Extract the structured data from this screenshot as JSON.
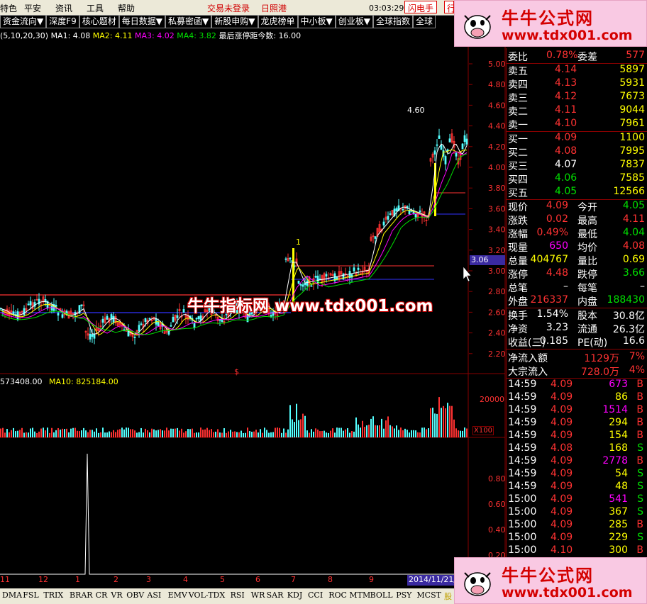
{
  "menubar": {
    "items": [
      "特色",
      "平安",
      "资讯",
      "工具",
      "帮助"
    ],
    "status_unlogged": "交易未登录",
    "stock_name": "日照港",
    "time": "03:03:29 周日",
    "flash_btn": "闪电手",
    "ctrl_btn": "行"
  },
  "toolbar": {
    "items": [
      "资金流向▼",
      "深度F9",
      "核心题材",
      "每日数据▼",
      "私募密函▼",
      "新股申购▼",
      "龙虎榜单",
      "中小板▼",
      "创业板▼",
      "全球指数",
      "全球"
    ]
  },
  "ma": {
    "prefix": "(5,10,20,30)",
    "ma1": "MA1: 4.08",
    "ma2": "MA2: 4.11",
    "ma3": "MA3: 4.02",
    "ma4": "MA4: 3.82",
    "limit_note": "最后涨停距今数: 16.00"
  },
  "price_axis": [
    "5.00",
    "4.80",
    "4.60",
    "4.40",
    "4.20",
    "4.00",
    "3.80",
    "3.60",
    "3.40",
    "3.20",
    "3.00",
    "2.80",
    "2.60",
    "2.40",
    "2.20"
  ],
  "current_price_tag": "3.06",
  "chart_labels": {
    "peak": "4.60",
    "signal_1": "1",
    "signal_marker": "$"
  },
  "volume": {
    "label_vol": "573408.00",
    "label_ma10": "MA10: 825184.00",
    "axis_top": "20000",
    "axis_unit": "X100"
  },
  "indicator": {
    "axis": [
      "0.80",
      "0.60",
      "0.40",
      "0.20"
    ]
  },
  "time_axis": [
    "11",
    "12",
    "1",
    "2",
    "3",
    "4",
    "5",
    "6",
    "7",
    "8",
    "9"
  ],
  "time_axis_date": "2014/11/21/",
  "quote": {
    "wei_bi_label": "委比",
    "wei_bi": "0.78%",
    "wei_cha_label": "委差",
    "wei_cha": "577",
    "asks": [
      {
        "label": "卖五",
        "price": "4.14",
        "vol": "5897"
      },
      {
        "label": "卖四",
        "price": "4.13",
        "vol": "5931"
      },
      {
        "label": "卖三",
        "price": "4.12",
        "vol": "7673"
      },
      {
        "label": "卖二",
        "price": "4.11",
        "vol": "9044"
      },
      {
        "label": "卖一",
        "price": "4.10",
        "vol": "7961"
      }
    ],
    "bids": [
      {
        "label": "买一",
        "price": "4.09",
        "vol": "1100"
      },
      {
        "label": "买二",
        "price": "4.08",
        "vol": "7995"
      },
      {
        "label": "买三",
        "price": "4.07",
        "vol": "7837"
      },
      {
        "label": "买四",
        "price": "4.06",
        "vol": "7585"
      },
      {
        "label": "买五",
        "price": "4.05",
        "vol": "12566"
      }
    ],
    "stats": [
      {
        "l1": "现价",
        "v1": "4.09",
        "l2": "今开",
        "v2": "4.05"
      },
      {
        "l1": "涨跌",
        "v1": "0.02",
        "l2": "最高",
        "v2": "4.11"
      },
      {
        "l1": "涨幅",
        "v1": "0.49%",
        "l2": "最低",
        "v2": "4.04"
      },
      {
        "l1": "现量",
        "v1": "650",
        "l2": "均价",
        "v2": "4.08"
      },
      {
        "l1": "总量",
        "v1": "404767",
        "l2": "量比",
        "v2": "0.69"
      },
      {
        "l1": "涨停",
        "v1": "4.48",
        "l2": "跌停",
        "v2": "3.66"
      },
      {
        "l1": "总笔",
        "v1": "–",
        "l2": "每笔",
        "v2": "–"
      },
      {
        "l1": "外盘",
        "v1": "216337",
        "l2": "内盘",
        "v2": "188430"
      }
    ],
    "fund": [
      {
        "l1": "换手",
        "v1": "1.54%",
        "l2": "股本",
        "v2": "30.8亿"
      },
      {
        "l1": "净资",
        "v1": "3.23",
        "l2": "流通",
        "v2": "26.3亿"
      },
      {
        "l1": "收益(三)",
        "v1": "0.185",
        "l2": "PE(动)",
        "v2": "16.6"
      }
    ],
    "flows": [
      {
        "label": "净流入额",
        "value": "1129万",
        "pct": "7%"
      },
      {
        "label": "大宗流入",
        "value": "728.0万",
        "pct": "4%"
      }
    ],
    "ticks": [
      {
        "time": "14:59",
        "price": "4.09",
        "vol": "673",
        "side": "B"
      },
      {
        "time": "14:59",
        "price": "4.09",
        "vol": "86",
        "side": "B"
      },
      {
        "time": "14:59",
        "price": "4.09",
        "vol": "1514",
        "side": "B"
      },
      {
        "time": "14:59",
        "price": "4.09",
        "vol": "294",
        "side": "B"
      },
      {
        "time": "14:59",
        "price": "4.09",
        "vol": "154",
        "side": "B"
      },
      {
        "time": "14:59",
        "price": "4.08",
        "vol": "168",
        "side": "S"
      },
      {
        "time": "14:59",
        "price": "4.09",
        "vol": "2778",
        "side": "B"
      },
      {
        "time": "14:59",
        "price": "4.09",
        "vol": "54",
        "side": "S"
      },
      {
        "time": "14:59",
        "price": "4.09",
        "vol": "48",
        "side": "S"
      },
      {
        "time": "15:00",
        "price": "4.09",
        "vol": "541",
        "side": "S"
      },
      {
        "time": "15:00",
        "price": "4.09",
        "vol": "367",
        "side": "S"
      },
      {
        "time": "15:00",
        "price": "4.09",
        "vol": "285",
        "side": "B"
      },
      {
        "time": "15:00",
        "price": "4.09",
        "vol": "229",
        "side": "S"
      },
      {
        "time": "15:00",
        "price": "4.10",
        "vol": "300",
        "side": "B"
      }
    ]
  },
  "indicator_tabs": [
    "DMA",
    "FSL",
    "TRIX",
    "BRAR",
    "CR",
    "VR",
    "OBV",
    "ASI",
    "EMV",
    "VOL-TDX",
    "RSI",
    "WR",
    "SAR",
    "KDJ",
    "CCI",
    "ROC",
    "MTM",
    "BOLL",
    "PSY",
    "MCST"
  ],
  "bottom_right": "股",
  "watermarks": {
    "brand": "牛牛公式网",
    "url": "www.tdx001.com",
    "center": "牛牛指标网 www.tdx001.com"
  },
  "colors": {
    "up": "#ff3232",
    "down": "#00e000",
    "flat": "#ffffff",
    "yellow": "#ffff00",
    "magenta": "#ff00ff"
  }
}
